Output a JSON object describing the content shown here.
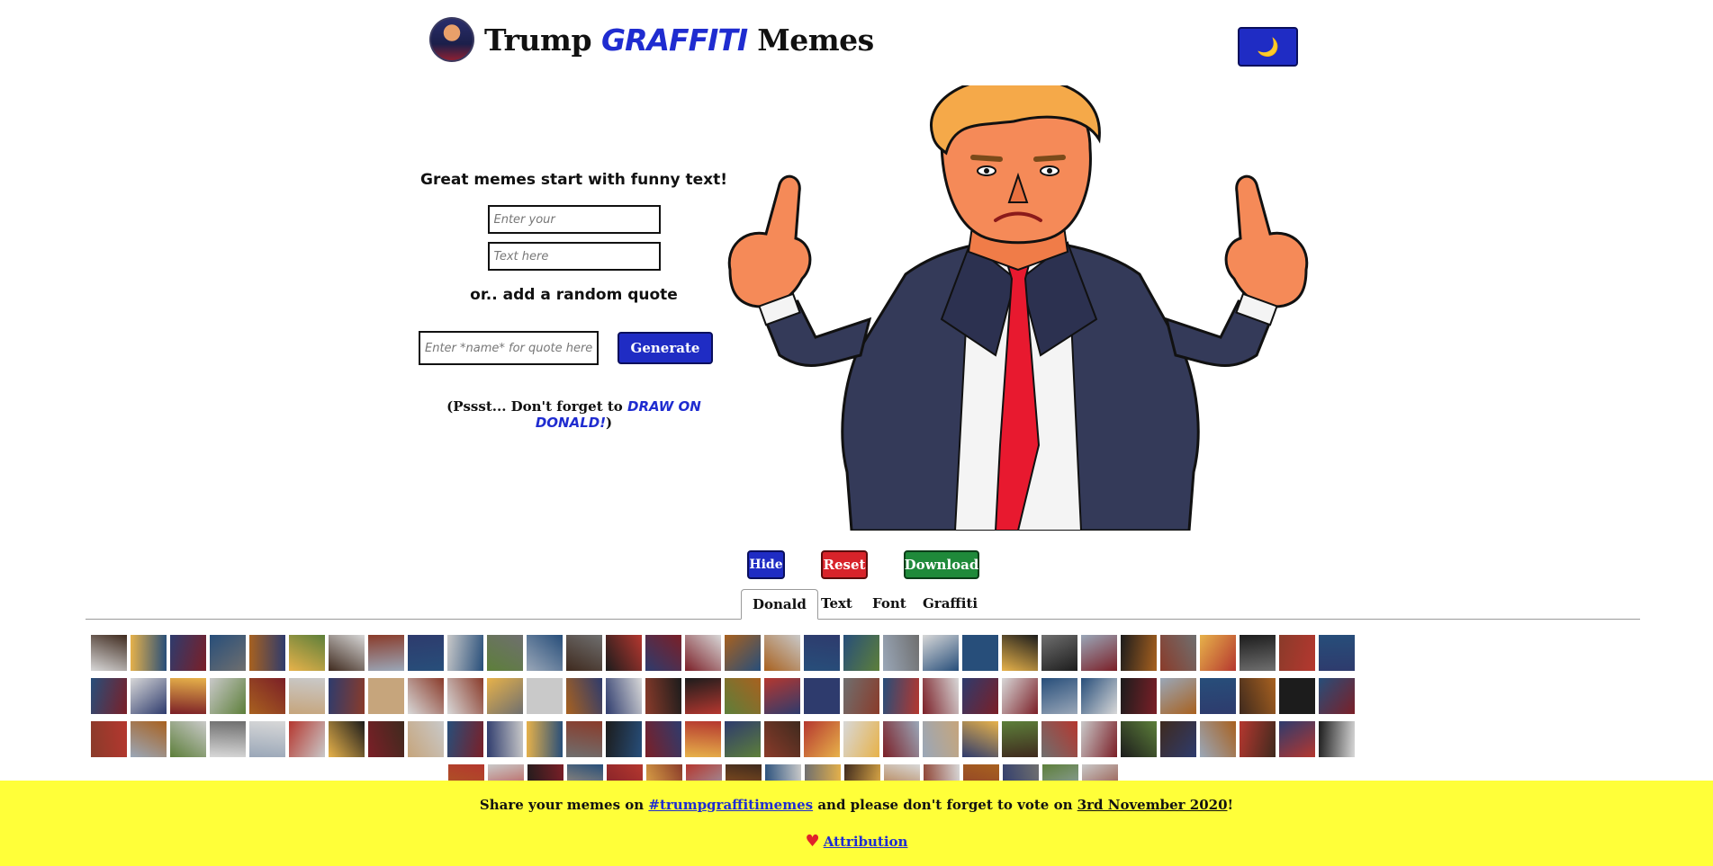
{
  "header": {
    "title_prefix": "Trump ",
    "title_highlight": "GRAFFITI",
    "title_suffix": " Memes",
    "theme_toggle_icon": "🌙"
  },
  "form": {
    "tagline": "Great memes start with funny text!",
    "line1_placeholder": "Enter your",
    "line2_placeholder": "Text here",
    "or_text": "or.. add a random quote",
    "quote_placeholder": "Enter *name* for quote here",
    "generate_label": "Generate",
    "pssst_prefix": "(Pssst... Don't forget to ",
    "pssst_link": "DRAW ON DONALD!",
    "pssst_suffix": ")"
  },
  "controls": {
    "hide_label": "Hide",
    "reset_label": "Reset",
    "download_label": "Download"
  },
  "tabs": [
    {
      "label": "Donald",
      "active": true
    },
    {
      "label": "Text",
      "active": false
    },
    {
      "label": "Font",
      "active": false
    },
    {
      "label": "Graffiti",
      "active": false
    }
  ],
  "footer": {
    "share_prefix": "Share your memes on ",
    "hashtag": "#trumpgraffitimemes",
    "vote_text": " and please don't forget to vote on ",
    "vote_date": "3rd November 2020",
    "exclaim": "!",
    "attribution": "Attribution"
  },
  "colors": {
    "accent_blue": "#1f2cc4",
    "reset_red": "#d8232a",
    "download_green": "#1f8a3a",
    "footer_yellow": "#ffff39"
  }
}
